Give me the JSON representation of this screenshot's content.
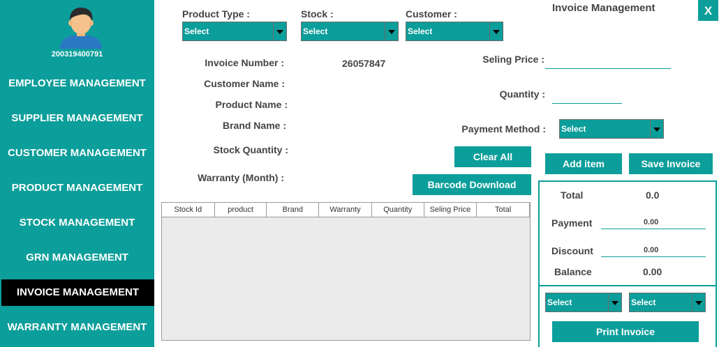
{
  "sidebar": {
    "user_id": "200319400791",
    "items": [
      {
        "label": "EMPLOYEE MANAGEMENT"
      },
      {
        "label": "SUPPLIER MANAGEMENT"
      },
      {
        "label": "CUSTOMER MANAGEMENT"
      },
      {
        "label": "PRODUCT MANAGEMENT"
      },
      {
        "label": "STOCK MANAGEMENT"
      },
      {
        "label": "GRN MANAGEMENT"
      },
      {
        "label": "INVOICE MANAGEMENT"
      },
      {
        "label": "WARRANTY MANAGEMENT"
      }
    ],
    "active_item": "INVOICE MANAGEMENT"
  },
  "header": {
    "title": "Invoice Management",
    "close_label": "X"
  },
  "filters": {
    "product_type": {
      "label": "Product  Type :",
      "value": "Select"
    },
    "stock": {
      "label": "Stock :",
      "value": "Select"
    },
    "customer": {
      "label": "Customer :",
      "value": "Select"
    }
  },
  "details": {
    "invoice_number_label": "Invoice Number :",
    "invoice_number_value": "26057847",
    "customer_name_label": "Customer Name :",
    "product_name_label": "Product Name :",
    "brand_name_label": "Brand Name :",
    "stock_quantity_label": "Stock Quantity :",
    "warranty_label": "Warranty (Month) :"
  },
  "entry": {
    "selling_price_label": "Seling Price :",
    "selling_price_value": "",
    "quantity_label": "Quantity :",
    "quantity_value": "",
    "payment_method_label": "Payment Method :",
    "payment_method_value": "Select"
  },
  "buttons": {
    "clear_all": "Clear All",
    "barcode_download": "Barcode Download",
    "add_item": "Add item",
    "save_invoice": "Save Invoice",
    "print_invoice": "Print Invoice"
  },
  "table": {
    "columns": [
      "Stock Id",
      "product",
      "Brand",
      "Warranty",
      "Quantity",
      "Seling Price",
      "Total"
    ],
    "rows": []
  },
  "summary": {
    "total_label": "Total",
    "total_value": "0.0",
    "payment_label": "Payment",
    "payment_value": "0.00",
    "discount_label": "Discount",
    "discount_value": "0.00",
    "balance_label": "Balance",
    "balance_value": "0.00"
  },
  "print_options": {
    "left_value": "Select",
    "right_value": "Select"
  },
  "colors": {
    "accent": "#0c9e9a",
    "active_nav": "#000000",
    "text": "#444444"
  }
}
